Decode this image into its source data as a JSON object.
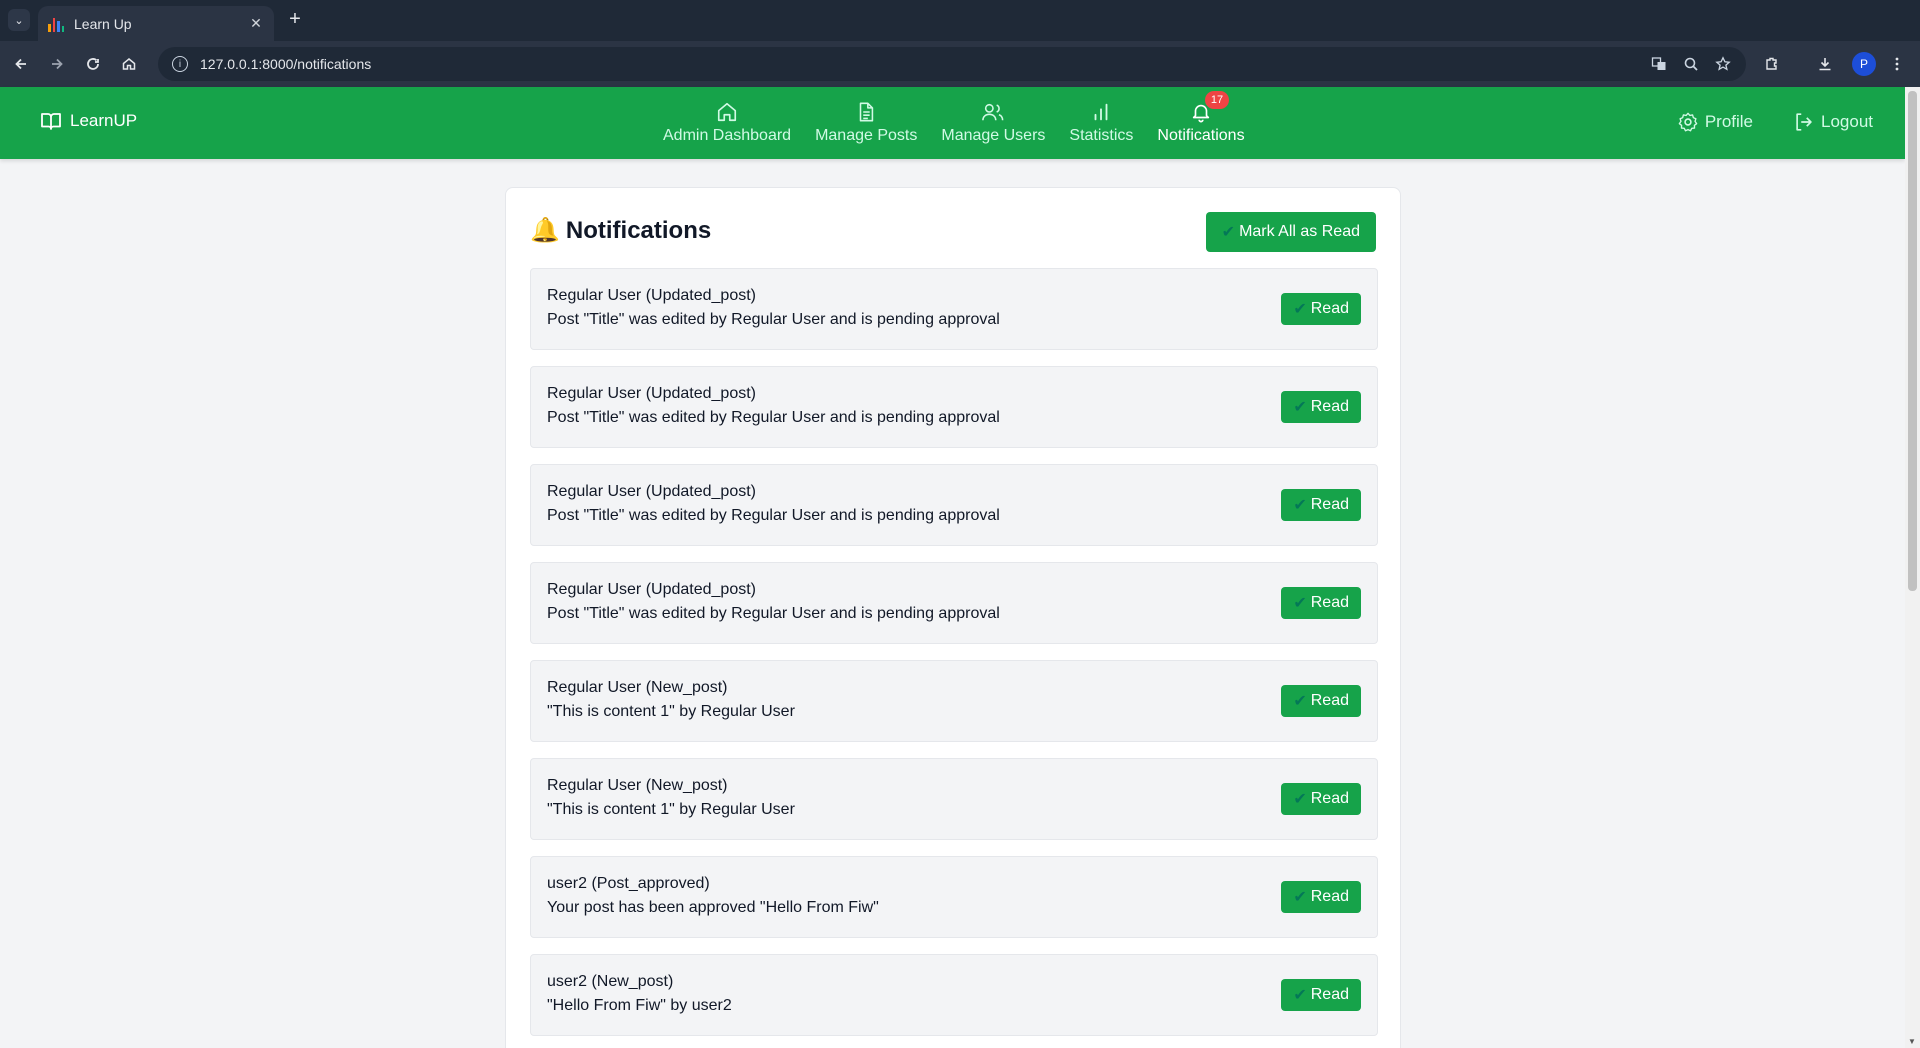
{
  "browser": {
    "tab_title": "Learn Up",
    "url": "127.0.0.1:8000/notifications",
    "avatar_letter": "P"
  },
  "app": {
    "brand": "LearnUP",
    "nav": [
      {
        "label": "Admin Dashboard",
        "icon": "home-icon"
      },
      {
        "label": "Manage Posts",
        "icon": "document-icon"
      },
      {
        "label": "Manage Users",
        "icon": "users-icon"
      },
      {
        "label": "Statistics",
        "icon": "chart-icon"
      },
      {
        "label": "Notifications",
        "icon": "bell-icon",
        "badge": "17",
        "active": true
      }
    ],
    "profile_label": "Profile",
    "logout_label": "Logout",
    "colors": {
      "brand": "#16a34a",
      "badge": "#ef4444"
    }
  },
  "page": {
    "title_emoji": "🔔",
    "title": "Notifications",
    "mark_all_label": "Mark All as Read",
    "check_glyph": "✔",
    "notifications": [
      {
        "header": "Regular User (Updated_post)",
        "message": "Post \"Title\" was edited by Regular User and is pending approval",
        "action": "Read"
      },
      {
        "header": "Regular User (Updated_post)",
        "message": "Post \"Title\" was edited by Regular User and is pending approval",
        "action": "Read"
      },
      {
        "header": "Regular User (Updated_post)",
        "message": "Post \"Title\" was edited by Regular User and is pending approval",
        "action": "Read"
      },
      {
        "header": "Regular User (Updated_post)",
        "message": "Post \"Title\" was edited by Regular User and is pending approval",
        "action": "Read"
      },
      {
        "header": "Regular User (New_post)",
        "message": "\"This is content 1\" by Regular User",
        "action": "Read"
      },
      {
        "header": "Regular User (New_post)",
        "message": "\"This is content 1\" by Regular User",
        "action": "Read"
      },
      {
        "header": "user2 (Post_approved)",
        "message": "Your post has been approved \"Hello From Fiw\"",
        "action": "Read"
      },
      {
        "header": "user2 (New_post)",
        "message": "\"Hello From Fiw\" by user2",
        "action": "Read"
      }
    ]
  }
}
